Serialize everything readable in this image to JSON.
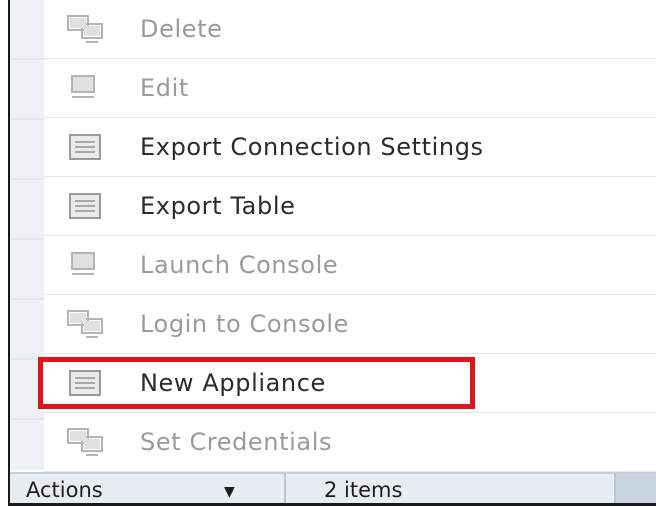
{
  "menu": {
    "items": [
      {
        "label": "Delete",
        "icon": "multi-monitor-icon",
        "enabled": false
      },
      {
        "label": "Edit",
        "icon": "monitor-icon",
        "enabled": false
      },
      {
        "label": "Export Connection Settings",
        "icon": "document-icon",
        "enabled": true
      },
      {
        "label": "Export Table",
        "icon": "document-icon",
        "enabled": true
      },
      {
        "label": "Launch Console",
        "icon": "monitor-icon",
        "enabled": false
      },
      {
        "label": "Login to Console",
        "icon": "multi-monitor-icon",
        "enabled": false
      },
      {
        "label": "New Appliance",
        "icon": "document-icon",
        "enabled": true,
        "highlighted": true
      },
      {
        "label": "Set Credentials",
        "icon": "multi-monitor-icon",
        "enabled": false
      }
    ]
  },
  "footer": {
    "actions_label": "Actions",
    "actions_caret": "▼",
    "item_count": "2 items"
  },
  "colors": {
    "highlight": "#e3131b",
    "enabled_text": "#2b2b2b",
    "disabled_text": "#9a9a9a",
    "footer_bg": "#e8edf3"
  }
}
